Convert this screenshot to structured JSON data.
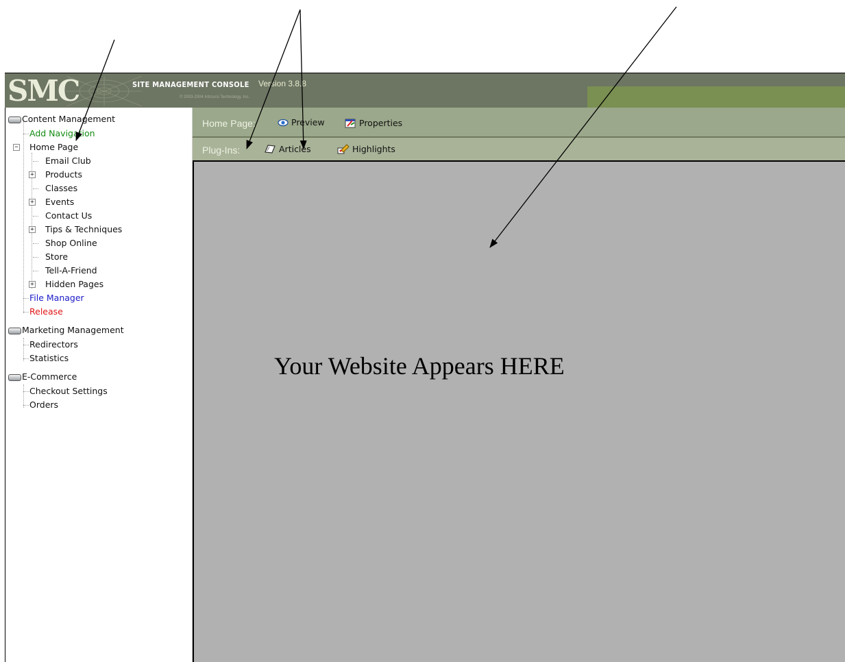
{
  "header": {
    "logo": "SMC",
    "console_title": "SITE MANAGEMENT CONSOLE",
    "version": "Version 3.8.8",
    "copyright": "© 2003-2004 Intrcursi Technology, Inc."
  },
  "sidebar": {
    "sections": [
      {
        "title": "Content Management",
        "icon": "drive-icon",
        "items": [
          {
            "label": "Add Navigation",
            "color": "#118a11"
          },
          {
            "label": "Home Page",
            "expanded": true,
            "children": [
              {
                "label": "Email Club"
              },
              {
                "label": "Products",
                "expandable": true
              },
              {
                "label": "Classes"
              },
              {
                "label": "Events",
                "expandable": true
              },
              {
                "label": "Contact Us"
              },
              {
                "label": "Tips & Techniques",
                "expandable": true
              },
              {
                "label": "Shop Online"
              },
              {
                "label": "Store"
              },
              {
                "label": "Tell-A-Friend"
              },
              {
                "label": "Hidden Pages",
                "expandable": true
              }
            ]
          },
          {
            "label": "File Manager",
            "color": "#1a1ac8"
          },
          {
            "label": "Release",
            "color": "#e01515"
          }
        ]
      },
      {
        "title": "Marketing Management",
        "icon": "drive-icon",
        "items": [
          {
            "label": "Redirectors"
          },
          {
            "label": "Statistics"
          }
        ]
      },
      {
        "title": "E-Commerce",
        "icon": "drive-icon",
        "items": [
          {
            "label": "Checkout Settings"
          },
          {
            "label": "Orders"
          }
        ]
      }
    ]
  },
  "toolbar_home": {
    "label": "Home Page:",
    "preview": "Preview",
    "properties": "Properties"
  },
  "toolbar_plugins": {
    "label": "Plug-Ins:",
    "articles": "Articles",
    "highlights": "Highlights"
  },
  "content": {
    "placeholder": "Your Website Appears HERE"
  },
  "colors": {
    "header_bg": "#6d7563",
    "header_accent": "#7a8f52",
    "toolbar_bg": "#9ba88b",
    "content_bg": "#b1b1b1",
    "add_navigation": "#118a11",
    "file_manager": "#1a1ac8",
    "release": "#e01515"
  }
}
